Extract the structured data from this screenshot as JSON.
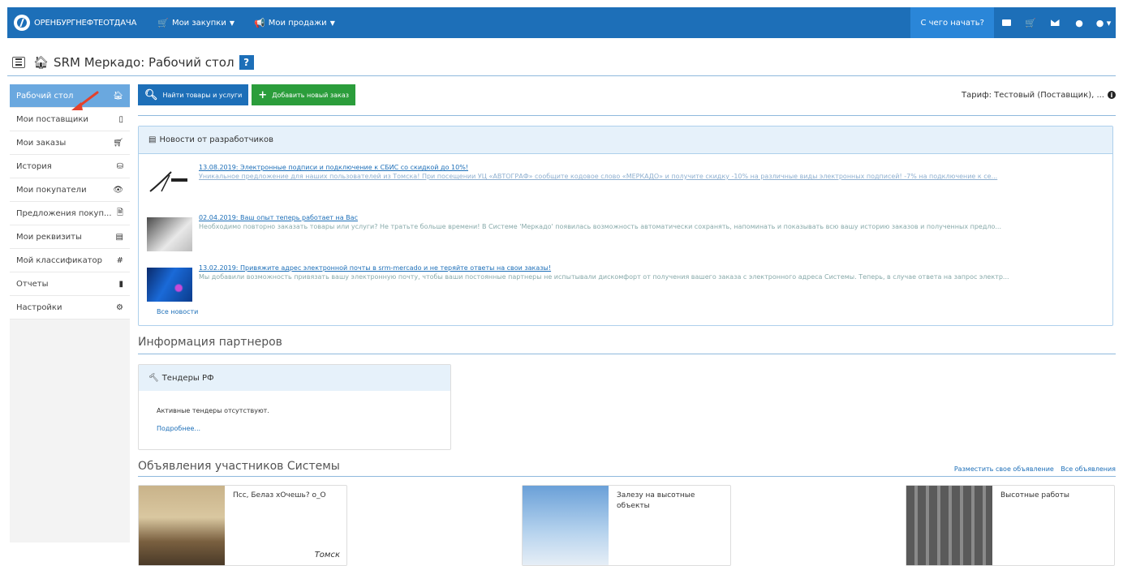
{
  "topbar": {
    "brand": "ОРЕНБУРГНЕФТЕОТДАЧА",
    "menu": [
      {
        "label": "Мои закупки",
        "icon": "cart-icon"
      },
      {
        "label": "Мои продажи",
        "icon": "megaphone-icon"
      }
    ],
    "start_label": "С чего начать?",
    "right_icons": [
      "list-icon",
      "cart-icon",
      "envelope-icon",
      "chat-icon",
      "user-icon"
    ]
  },
  "header": {
    "title": "SRM Меркадо: Рабочий стол",
    "help": "?"
  },
  "sidebar": {
    "items": [
      {
        "label": "Рабочий стол",
        "icon": "home-icon",
        "glyph": "🏠"
      },
      {
        "label": "Мои поставщики",
        "icon": "book-icon",
        "glyph": "▯"
      },
      {
        "label": "Мои заказы",
        "icon": "cart-icon",
        "glyph": "🛒"
      },
      {
        "label": "История",
        "icon": "archive-icon",
        "glyph": "⛁"
      },
      {
        "label": "Мои покупатели",
        "icon": "eye-icon",
        "glyph": "👁"
      },
      {
        "label": "Предложения покуп...",
        "icon": "document-icon",
        "glyph": "🗎"
      },
      {
        "label": "Мои реквизиты",
        "icon": "id-card-icon",
        "glyph": "▤"
      },
      {
        "label": "Мой классификатор",
        "icon": "hash-icon",
        "glyph": "#"
      },
      {
        "label": "Отчеты",
        "icon": "file-icon",
        "glyph": "▮"
      },
      {
        "label": "Настройки",
        "icon": "gears-icon",
        "glyph": "⚙"
      }
    ]
  },
  "actions": {
    "find_label": "Найти товары и услуги",
    "add_label": "Добавить новый заказ",
    "tariff": "Тариф: Тестовый (Поставщик), ..."
  },
  "news": {
    "title": "Новости от разработчиков",
    "items": [
      {
        "headline": "13.08.2019: Электронные подписи и подключение к СБИС со скидкой до 10%!",
        "body": "Уникальное предложение для наших пользователей из Томска! При посещении УЦ «АВТОГРАФ» сообщите кодовое слово «МЕРКАДО» и получите скидку -10% на различные виды электронных подписей! -7% на подключение к се...",
        "body_is_link": true
      },
      {
        "headline": "02.04.2019: Ваш опыт теперь работает на Вас",
        "body": "Необходимо повторно заказать товары или услуги? Не тратьте больше времени! В Системе 'Меркадо' появилась возможность автоматически сохранять, напоминать и показывать всю вашу историю заказов и полученных предло...",
        "body_is_link": false
      },
      {
        "headline": "13.02.2019: Привяжите адрес электронной почты в srm-mercado и не теряйте ответы на свои заказы!",
        "body": "Мы добавили возможность привязать вашу электронную почту, чтобы ваши постоянные партнеры не испытывали дискомфорт от получения вашего заказа с электронного адреса Системы. Теперь, в случае ответа на запрос электр...",
        "body_is_link": false
      }
    ],
    "all_label": "Все новости"
  },
  "partners": {
    "section_title": "Информация партнеров",
    "box_title": "Тендеры РФ",
    "text": "Активные тендеры отсутствуют.",
    "more": "Подробнее..."
  },
  "ads": {
    "section_title": "Объявления участников Системы",
    "link_post": "Разместить свое объявление",
    "link_all": "Все объявления",
    "items": [
      {
        "title": "Псс, Белаз хОчешь? о_О",
        "city": "Томск"
      },
      {
        "title": "Залезу на высотные объекты",
        "city": ""
      },
      {
        "title": "Высотные работы",
        "city": ""
      }
    ]
  },
  "colors": {
    "topbar": "#1d6fb8",
    "sidebar_active": "#6aa8df",
    "green_button": "#2b9d3b",
    "panel_header": "#e6f1fa"
  }
}
